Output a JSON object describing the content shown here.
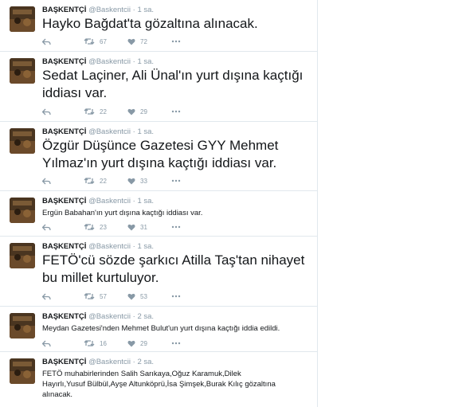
{
  "account": {
    "name": "BAŞKENTÇİ",
    "handle": "@Baskentcii"
  },
  "tweets": [
    {
      "time": "1 sa.",
      "text": "Hayko Bağdat'ta gözaltına alınacak.",
      "retweets": "67",
      "likes": "72"
    },
    {
      "time": "1 sa.",
      "text": "Sedat Laçiner, Ali Ünal'ın yurt dışına kaçtığı iddiası var.",
      "retweets": "22",
      "likes": "29"
    },
    {
      "time": "1 sa.",
      "text": "Özgür Düşünce Gazetesi GYY Mehmet Yılmaz'ın yurt dışına kaçtığı iddiası var.",
      "retweets": "22",
      "likes": "33"
    },
    {
      "time": "1 sa.",
      "text": "Ergün Babahan'ın yurt dışına kaçtığı iddiası var.",
      "retweets": "23",
      "likes": "31"
    },
    {
      "time": "1 sa.",
      "text": "FETÖ'cü sözde şarkıcı Atilla Taş'tan nihayet bu millet kurtuluyor.",
      "retweets": "57",
      "likes": "53"
    },
    {
      "time": "2 sa.",
      "text": "Meydan Gazetesi'nden Mehmet Bulut'un yurt dışına kaçtığı iddia edildi.",
      "retweets": "16",
      "likes": "29"
    },
    {
      "time": "2 sa.",
      "text": "FETÖ muhabirlerinden Salih Sarıkaya,Oğuz Karamuk,Dilek Hayırlı,Yusuf Bülbül,Ayşe Altunköprü,İsa Şimşek,Burak Kılıç gözaltına alınacak.",
      "retweets": "",
      "likes": ""
    }
  ],
  "meta_separator": "·",
  "icons": {
    "reply": "reply-icon",
    "retweet": "retweet-icon",
    "like": "heart-icon",
    "more": "more-icon"
  },
  "colors": {
    "muted": "#8899a6",
    "text": "#14171a",
    "divider": "#e1e8ed"
  }
}
